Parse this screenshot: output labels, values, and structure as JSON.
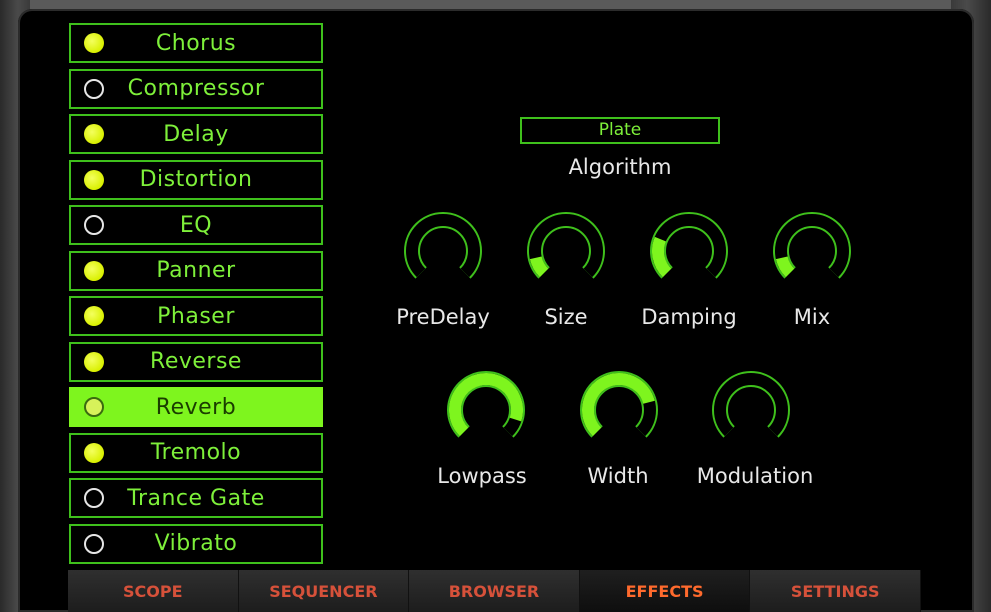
{
  "effects": [
    {
      "label": "Chorus",
      "enabled": true
    },
    {
      "label": "Compressor",
      "enabled": false
    },
    {
      "label": "Delay",
      "enabled": true
    },
    {
      "label": "Distortion",
      "enabled": true
    },
    {
      "label": "EQ",
      "enabled": false
    },
    {
      "label": "Panner",
      "enabled": true
    },
    {
      "label": "Phaser",
      "enabled": true
    },
    {
      "label": "Reverse",
      "enabled": true
    },
    {
      "label": "Reverb",
      "enabled": false,
      "selected": true
    },
    {
      "label": "Tremolo",
      "enabled": true
    },
    {
      "label": "Trance Gate",
      "enabled": false
    },
    {
      "label": "Vibrato",
      "enabled": false
    }
  ],
  "reverb": {
    "algorithm_value": "Plate",
    "algorithm_label": "Algorithm",
    "knobs": [
      {
        "label": "PreDelay",
        "value": 0.0
      },
      {
        "label": "Size",
        "value": 0.12
      },
      {
        "label": "Damping",
        "value": 0.25
      },
      {
        "label": "Mix",
        "value": 0.12
      },
      {
        "label": "Lowpass",
        "value": 0.9
      },
      {
        "label": "Width",
        "value": 0.78
      },
      {
        "label": "Modulation",
        "value": 0.0
      }
    ]
  },
  "tabs": [
    {
      "label": "SCOPE",
      "active": false
    },
    {
      "label": "SEQUENCER",
      "active": false
    },
    {
      "label": "BROWSER",
      "active": false
    },
    {
      "label": "EFFECTS",
      "active": true
    },
    {
      "label": "SETTINGS",
      "active": false
    }
  ],
  "colors": {
    "accent_green": "#7ef51e",
    "dim_green": "#1f6b12",
    "led_yellow": "#e4f81c",
    "tab_text": "#d6513a",
    "tab_active_text": "#ff6a2d"
  }
}
